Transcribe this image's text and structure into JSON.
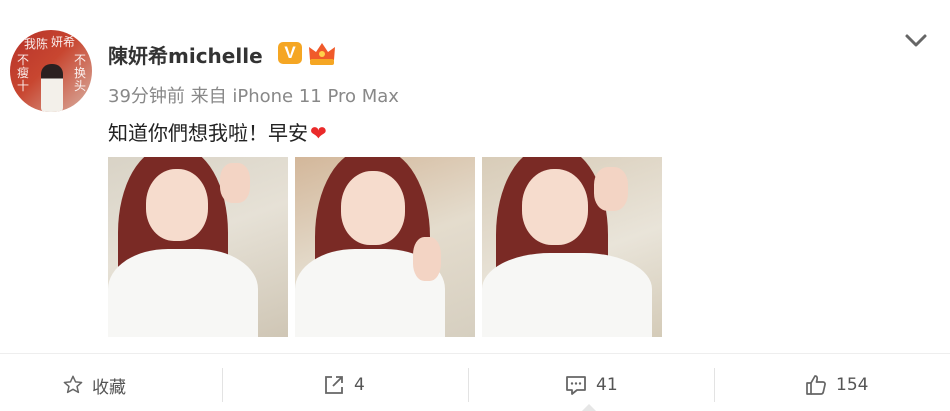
{
  "post": {
    "avatar_text": {
      "left_col": "我陈",
      "top_right": "妍希",
      "left_lower": "不瘦十",
      "right_lower": "不换头"
    },
    "username": "陳妍希michelle",
    "verified_badge": "V",
    "timestamp": "39分钟前",
    "source": "来自 iPhone 11 Pro Max",
    "text": "知道你們想我啦！早安",
    "text_emoji": "❤"
  },
  "actions": {
    "favorite_label": "收藏",
    "share_count": "4",
    "comment_count": "41",
    "like_count": "154"
  },
  "icons": [
    "chevron-down-icon",
    "star-icon",
    "share-icon",
    "comment-icon",
    "like-icon"
  ],
  "colors": {
    "badge": "#f5a623",
    "heart": "#ea2a2a",
    "hair": "#7a2a25"
  }
}
